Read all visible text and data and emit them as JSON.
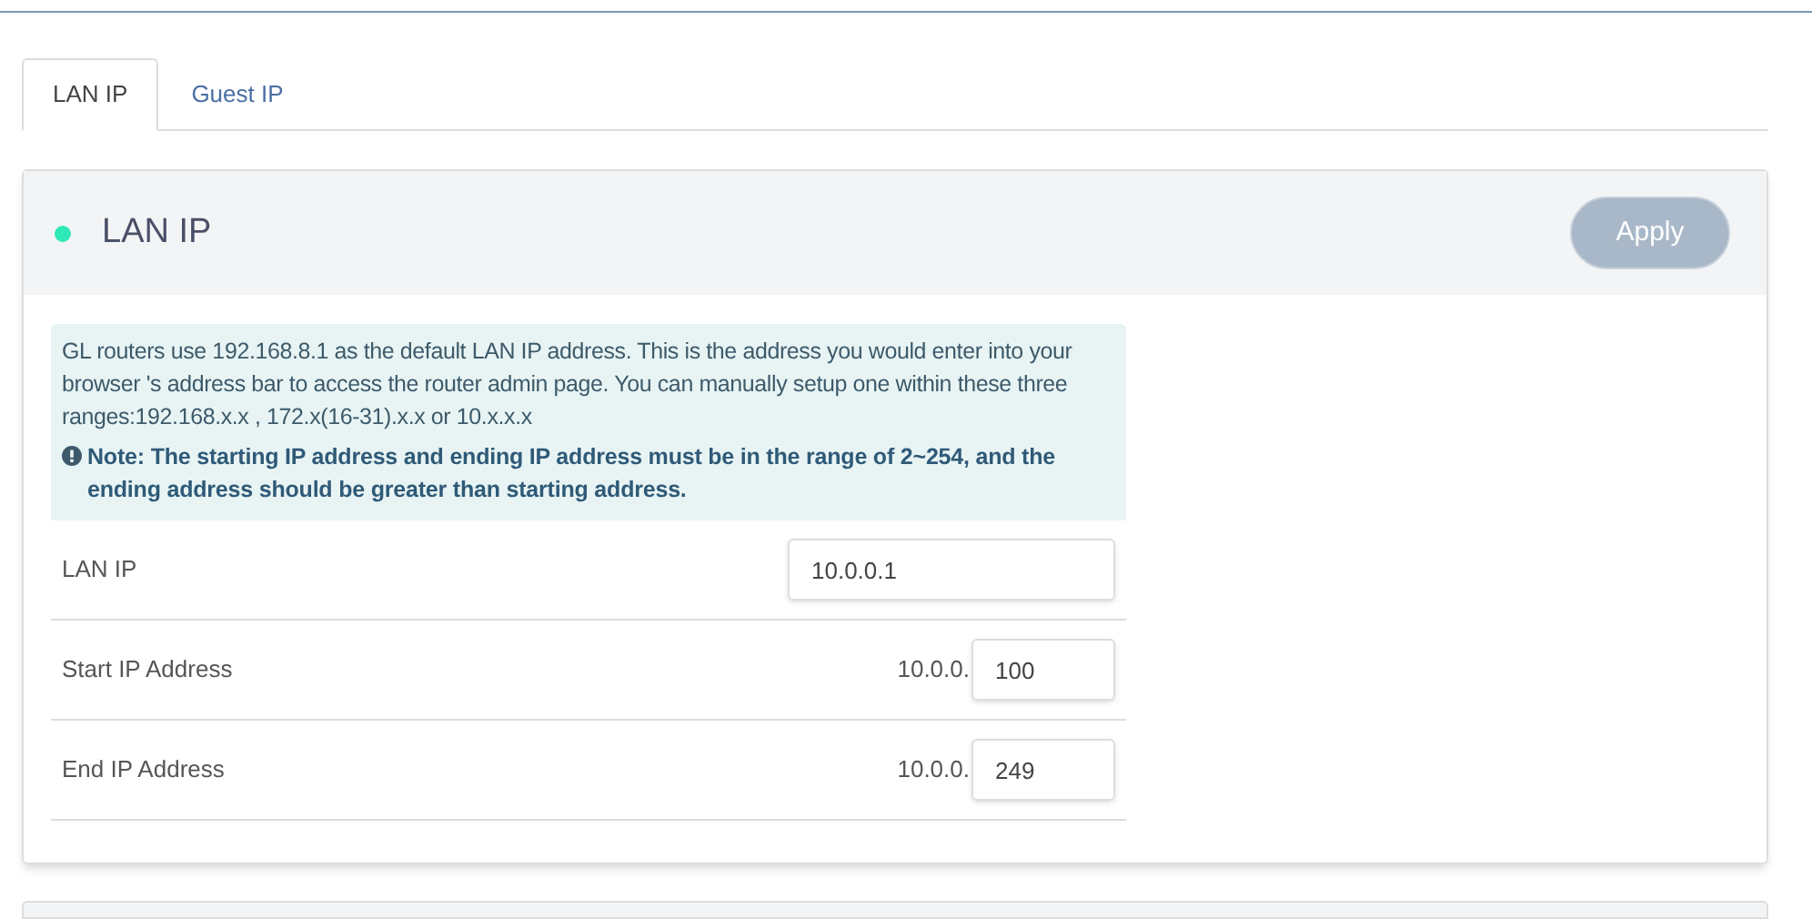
{
  "tabs": [
    {
      "label": "LAN IP",
      "selected": true
    },
    {
      "label": "Guest IP",
      "selected": false
    }
  ],
  "panel": {
    "title": "LAN IP",
    "active": true,
    "apply_button": {
      "label": "Apply",
      "disabled": true
    },
    "info": {
      "text": "GL routers use 192.168.8.1 as the default LAN IP address. This is the address you would enter into your browser 's address bar to access the router admin page. You can manually setup one within these three ranges:192.168.x.x , 172.x(16-31).x.x or 10.x.x.x",
      "note": "Note: The starting IP address and ending IP address must be in the range of 2~254, and the ending address should be greater than starting address."
    },
    "fields": [
      {
        "kind": "full",
        "label": "LAN IP",
        "value": "10.0.0.1"
      },
      {
        "kind": "suffix",
        "label": "Start IP Address",
        "prefix": "10.0.0.",
        "value": "100"
      },
      {
        "kind": "suffix",
        "label": "End IP Address",
        "prefix": "10.0.0.",
        "value": "249"
      }
    ]
  }
}
